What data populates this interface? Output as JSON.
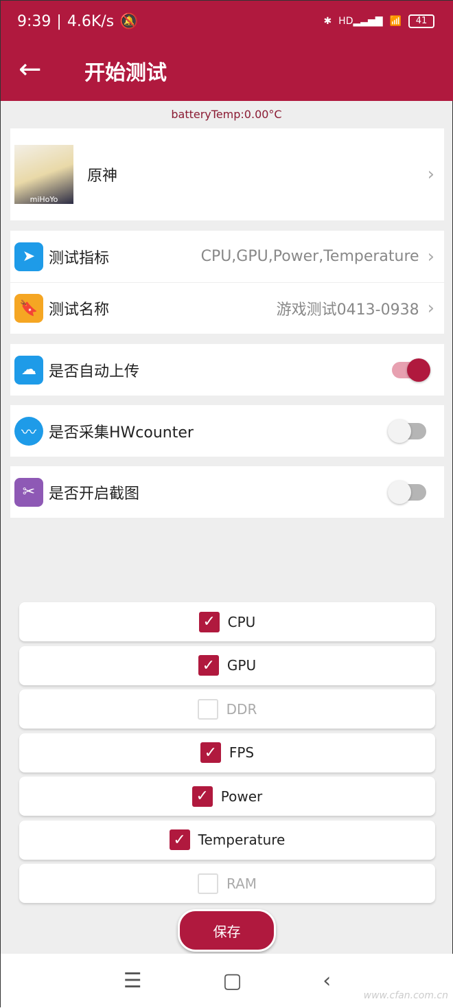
{
  "status": {
    "time": "9:39",
    "speed": "4.6K/s",
    "battery": "41",
    "network": "HD"
  },
  "header": {
    "title": "开始测试"
  },
  "battery_temp": "batteryTemp:0.00°C",
  "game": {
    "name": "原神",
    "logo_text": "miHoYo"
  },
  "settings": [
    {
      "label": "测试指标",
      "value": "CPU,GPU,Power,Temperature",
      "icon": "send-icon",
      "color": "#1e9be8"
    },
    {
      "label": "测试名称",
      "value": "游戏测试0413-0938",
      "icon": "bookmark-icon",
      "color": "#f5a623"
    }
  ],
  "toggles": [
    {
      "label": "是否自动上传",
      "on": true,
      "icon": "cloud-upload-icon",
      "color": "#1e9be8"
    },
    {
      "label": "是否采集HWcounter",
      "on": false,
      "icon": "pulse-icon",
      "color": "#1e9be8"
    },
    {
      "label": "是否开启截图",
      "on": false,
      "icon": "scissors-icon",
      "color": "#8e59b5"
    }
  ],
  "metrics": [
    {
      "label": "CPU",
      "checked": true
    },
    {
      "label": "GPU",
      "checked": true
    },
    {
      "label": "DDR",
      "checked": false
    },
    {
      "label": "FPS",
      "checked": true
    },
    {
      "label": "Power",
      "checked": true
    },
    {
      "label": "Temperature",
      "checked": true
    },
    {
      "label": "RAM",
      "checked": false
    }
  ],
  "save_label": "保存",
  "accent": "#b0193e",
  "watermark": "www.cfan.com.cn"
}
